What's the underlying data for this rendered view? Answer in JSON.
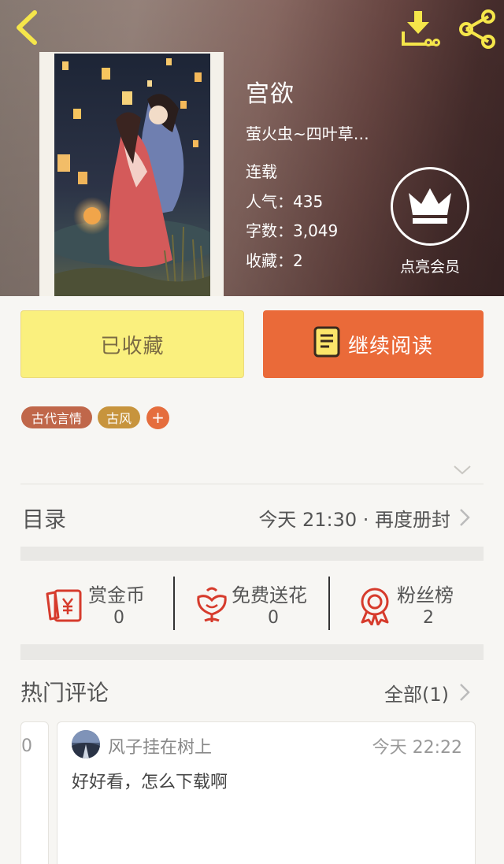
{
  "header": {
    "icons": {
      "back": "back-chevron-icon",
      "download": "download-icon",
      "share": "share-icon"
    }
  },
  "book": {
    "title": "宫欲",
    "author": "萤火虫~四叶草…",
    "status": "连载",
    "popularity": "人气：435",
    "word_count": "字数：3,049",
    "favorites": "收藏：2"
  },
  "vip": {
    "label": "点亮会员",
    "icon": "crown-icon"
  },
  "actions": {
    "collected_label": "已收藏",
    "read_label": "继续阅读"
  },
  "tags": {
    "items": [
      "古代言情",
      "古风"
    ],
    "add_label": "+"
  },
  "catalog": {
    "title": "目录",
    "latest": "今天 21:30 · 再度册封"
  },
  "rewards": {
    "coin": {
      "label": "赏金币",
      "count": "0"
    },
    "flower": {
      "label": "免费送花",
      "count": "0"
    },
    "fans": {
      "label": "粉丝榜",
      "count": "2"
    }
  },
  "comments": {
    "title": "热门评论",
    "all_label": "全部(1)",
    "prev_card_text": "0",
    "items": [
      {
        "user": "风子挂在树上",
        "time": "今天 22:22",
        "text": "好好看，怎么下载啊"
      }
    ]
  },
  "colors": {
    "accent": "#ea6a39",
    "collected_bg": "#faf07e",
    "tag1": "#c0674a",
    "tag2": "#c7943d",
    "icon_red": "#d63b2c"
  }
}
